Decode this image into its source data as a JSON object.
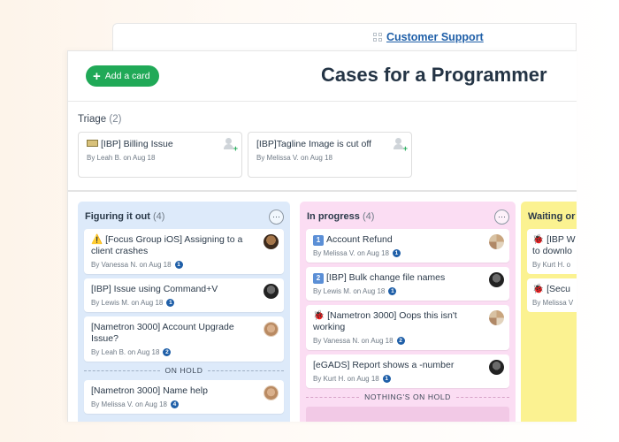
{
  "board_link": {
    "label": "Customer Support"
  },
  "header": {
    "add_card": "Add a card",
    "title": "Cases for a Programmer"
  },
  "triage": {
    "title": "Triage",
    "count": "(2)",
    "cards": [
      {
        "title": "[IBP] Billing Issue",
        "meta": "By Leah B. on Aug 18"
      },
      {
        "title": "[IBP]Tagline Image is cut off",
        "meta": "By Melissa V. on Aug 18"
      }
    ]
  },
  "columns": [
    {
      "title": "Figuring it out",
      "count": "(4)",
      "cards": [
        {
          "icon": "⚠️",
          "title": "[Focus Group iOS] Assigning to a client crashes",
          "meta": "By Vanessa N. on Aug 18",
          "badge": "1"
        },
        {
          "title": "[IBP] Issue using Command+V",
          "meta": "By Lewis M. on Aug 18",
          "badge": "1"
        },
        {
          "title": "[Nametron 3000] Account Upgrade Issue?",
          "meta": "By Leah B. on Aug 18",
          "badge": "2"
        }
      ],
      "divider": "ON HOLD",
      "hold_cards": [
        {
          "title": "[Nametron 3000] Name help",
          "meta": "By Melissa V. on Aug 18",
          "badge": "4"
        }
      ]
    },
    {
      "title": "In progress",
      "count": "(4)",
      "cards": [
        {
          "num": "1",
          "title": "Account Refund",
          "meta": "By Melissa V. on Aug 18",
          "badge": "1"
        },
        {
          "num": "2",
          "title": "[IBP] Bulk change file names",
          "meta": "By Lewis M. on Aug 18",
          "badge": "1"
        },
        {
          "icon": "🐞",
          "title": "[Nametron 3000] Oops this isn't working",
          "meta": "By Vanessa N. on Aug 18",
          "badge": "2"
        },
        {
          "title": "[eGADS] Report shows a -number",
          "meta": "By Kurt H. on Aug 18",
          "badge": "1"
        }
      ],
      "divider": "NOTHING'S ON HOLD"
    },
    {
      "title": "Waiting or",
      "cards": [
        {
          "icon": "🐞",
          "title": "[IBP W",
          "title2": "to downlo",
          "meta": "By Kurt H. o"
        },
        {
          "icon": "🐞",
          "title": "[Secu",
          "meta": "By Melissa V"
        }
      ]
    }
  ]
}
